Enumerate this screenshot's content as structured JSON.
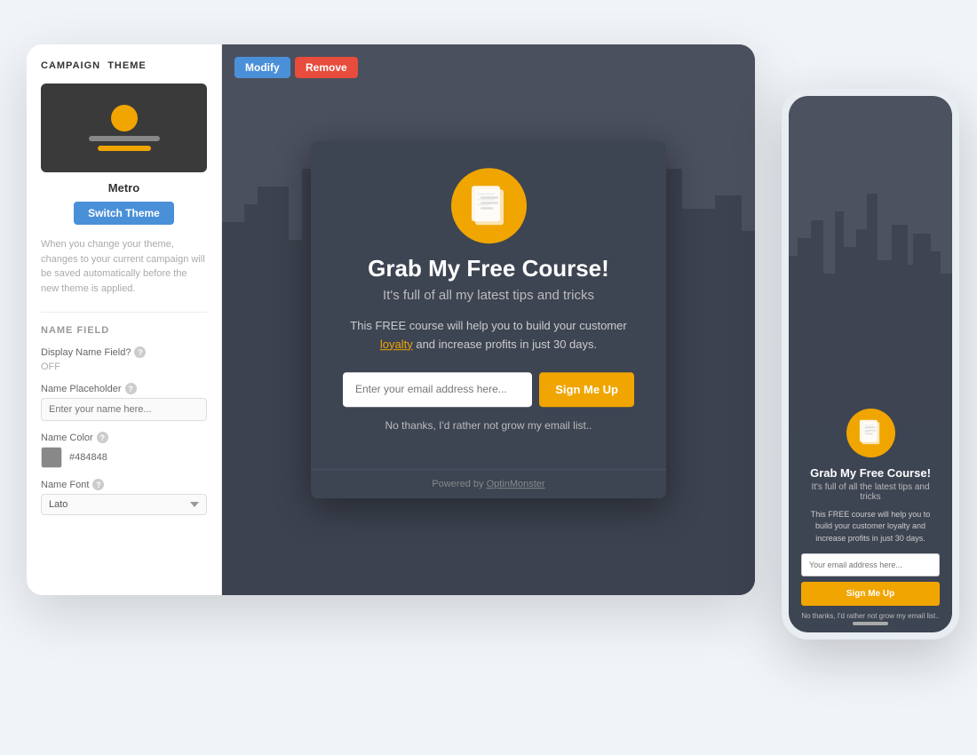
{
  "sidebar": {
    "section_title_prefix": "CAMPAIGN",
    "section_title_bold": "THEME",
    "theme_name": "Metro",
    "switch_theme_label": "Switch Theme",
    "description": "When you change your theme, changes to your current campaign will be saved automatically before the new theme is applied.",
    "name_field_label": "NAME FIELD",
    "display_name_label": "Display Name Field?",
    "display_name_status": "OFF",
    "name_placeholder_label": "Name Placeholder",
    "name_placeholder_value": "Enter your name here...",
    "name_color_label": "Name Color",
    "name_color_hex": "#484848",
    "name_font_label": "Name Font",
    "name_font_value": "Lato"
  },
  "preview_buttons": {
    "modify": "Modify",
    "remove": "Remove"
  },
  "popup": {
    "title": "Grab My Free Course!",
    "subtitle": "It's full of all my latest tips and tricks",
    "description_1": "This FREE course will help you to build your customer",
    "description_highlight": "loyalty",
    "description_2": "and increase profits in just 30 days.",
    "email_placeholder": "Enter your email address here...",
    "submit_label": "Sign Me Up",
    "no_thanks": "No thanks, I'd rather not grow my email list..",
    "powered_prefix": "Powered by",
    "powered_link": "OptinMonster"
  },
  "mobile_popup": {
    "title": "Grab My Free Course!",
    "subtitle": "It's full of all the latest tips and tricks",
    "description": "This FREE course will help you to build your customer loyalty and increase profits in just 30 days.",
    "email_placeholder": "Your email address here...",
    "submit_label": "Sign Me Up",
    "no_thanks": "No thanks, I'd rather not grow my email list.."
  },
  "colors": {
    "accent_yellow": "#f0a500",
    "popup_bg": "#3d4452",
    "modify_blue": "#4a90d9",
    "remove_red": "#e74c3c",
    "city_bg": "#5a6070"
  }
}
